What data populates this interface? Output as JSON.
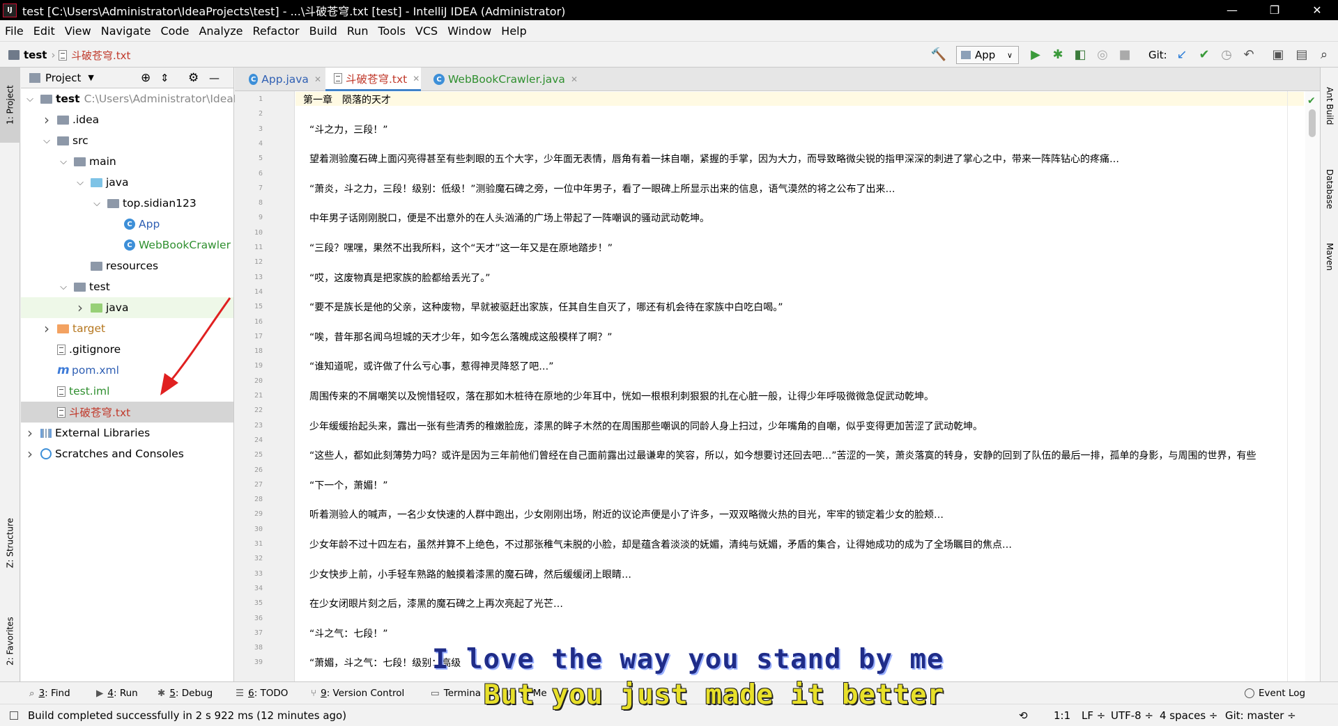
{
  "window": {
    "title": "test [C:\\Users\\Administrator\\IdeaProjects\\test] - ...\\斗破苍穹.txt [test] - IntelliJ IDEA (Administrator)",
    "app_icon": "IJ",
    "controls": [
      "—",
      "❐",
      "✕"
    ]
  },
  "menu": [
    "File",
    "Edit",
    "View",
    "Navigate",
    "Code",
    "Analyze",
    "Refactor",
    "Build",
    "Run",
    "Tools",
    "VCS",
    "Window",
    "Help"
  ],
  "breadcrumb": {
    "project": "test",
    "file": "斗破苍穹.txt"
  },
  "toolbar": {
    "run_config": "App",
    "git_label": "Git:"
  },
  "left_tool_tabs": {
    "project": "1: Project",
    "structure": "Z: Structure",
    "favorites": "2: Favorites"
  },
  "right_tool_tabs": {
    "ant": "Ant Build",
    "database": "Database",
    "maven": "Maven"
  },
  "project_panel": {
    "title": "Project",
    "tree": [
      {
        "label": "test",
        "extra": "C:\\Users\\Administrator\\IdeaP",
        "depth": 0,
        "arrow": "v",
        "icon": "folder"
      },
      {
        "label": ".idea",
        "depth": 1,
        "arrow": ">",
        "icon": "folder"
      },
      {
        "label": "src",
        "depth": 1,
        "arrow": "v",
        "icon": "folder"
      },
      {
        "label": "main",
        "depth": 2,
        "arrow": "v",
        "icon": "folder"
      },
      {
        "label": "java",
        "depth": 3,
        "arrow": "v",
        "icon": "folder-blue"
      },
      {
        "label": "top.sidian123",
        "depth": 4,
        "arrow": "v",
        "icon": "folder"
      },
      {
        "label": "App",
        "depth": 5,
        "arrow": "",
        "icon": "class",
        "color": "#2f5fb3"
      },
      {
        "label": "WebBookCrawler",
        "depth": 5,
        "arrow": "",
        "icon": "class",
        "color": "#2f8f2f"
      },
      {
        "label": "resources",
        "depth": 3,
        "arrow": "",
        "icon": "folder"
      },
      {
        "label": "test",
        "depth": 2,
        "arrow": "v",
        "icon": "folder"
      },
      {
        "label": "java",
        "depth": 3,
        "arrow": ">",
        "icon": "folder-green",
        "tested": true
      },
      {
        "label": "target",
        "depth": 1,
        "arrow": ">",
        "icon": "folder-orange",
        "color": "#b5761e"
      },
      {
        "label": ".gitignore",
        "depth": 1,
        "arrow": "",
        "icon": "file"
      },
      {
        "label": "pom.xml",
        "depth": 1,
        "arrow": "",
        "icon": "maven",
        "color": "#2f5fb3"
      },
      {
        "label": "test.iml",
        "depth": 1,
        "arrow": "",
        "icon": "file",
        "color": "#2f8f2f"
      },
      {
        "label": "斗破苍穹.txt",
        "depth": 1,
        "arrow": "",
        "icon": "file",
        "color": "#c0392b",
        "selected": true
      },
      {
        "label": "External Libraries",
        "depth": 0,
        "arrow": ">",
        "icon": "library"
      },
      {
        "label": "Scratches and Consoles",
        "depth": 0,
        "arrow": ">",
        "icon": "scratch"
      }
    ]
  },
  "tabs": [
    {
      "label": "App.java",
      "icon": "class",
      "color": "#2f5fb3"
    },
    {
      "label": "斗破苍穹.txt",
      "icon": "file",
      "color": "#c0392b",
      "active": true
    },
    {
      "label": "WebBookCrawler.java",
      "icon": "class",
      "color": "#2f8f2f"
    }
  ],
  "editor": {
    "line_numbers": [
      "1",
      "2",
      "3",
      "4",
      "5",
      "6",
      "7",
      "8",
      "9",
      "10",
      "11",
      "12",
      "13",
      "14",
      "15",
      "16",
      "17",
      "18",
      "19",
      "20",
      "21",
      "22",
      "23",
      "24",
      "25",
      "26",
      "27",
      "28",
      "29",
      "30",
      "31",
      "32",
      "33",
      "34",
      "35",
      "36",
      "37",
      "38",
      "39"
    ],
    "text_lines": [
      {
        "line": 1,
        "text": "第一章　陨落的天才",
        "first": true
      },
      {
        "line": 3,
        "text": "“斗之力，三段！”"
      },
      {
        "line": 5,
        "text": "望着测验魔石碑上面闪亮得甚至有些刺眼的五个大字，少年面无表情，唇角有着一抹自嘲，紧握的手掌，因为大力，而导致略微尖锐的指甲深深的刺进了掌心之中，带来一阵阵钻心的疼痛…"
      },
      {
        "line": 7,
        "text": "“萧炎，斗之力，三段！级别：低级！”测验魔石碑之旁，一位中年男子，看了一眼碑上所显示出来的信息，语气漠然的将之公布了出来…"
      },
      {
        "line": 9,
        "text": "中年男子话刚刚脱口，便是不出意外的在人头汹涌的广场上带起了一阵嘲讽的骚动武动乾坤。"
      },
      {
        "line": 11,
        "text": "“三段？嘿嘿，果然不出我所料，这个“天才”这一年又是在原地踏步！”"
      },
      {
        "line": 13,
        "text": "“哎，这废物真是把家族的脸都给丢光了。”"
      },
      {
        "line": 15,
        "text": "“要不是族长是他的父亲，这种废物，早就被驱赶出家族，任其自生自灭了，哪还有机会待在家族中白吃白喝。”"
      },
      {
        "line": 17,
        "text": "“唉，昔年那名闻乌坦城的天才少年，如今怎么落魄成这般模样了啊？”"
      },
      {
        "line": 19,
        "text": "“谁知道呢，或许做了什么亏心事，惹得神灵降怒了吧…”"
      },
      {
        "line": 21,
        "text": "周围传来的不屑嘲笑以及惋惜轻叹，落在那如木桩待在原地的少年耳中，恍如一根根利刺狠狠的扎在心脏一般，让得少年呼吸微微急促武动乾坤。"
      },
      {
        "line": 23,
        "text": "少年缓缓抬起头来，露出一张有些清秀的稚嫩脸庞，漆黑的眸子木然的在周围那些嘲讽的同龄人身上扫过，少年嘴角的自嘲，似乎变得更加苦涩了武动乾坤。"
      },
      {
        "line": 25,
        "text": "“这些人，都如此刻薄势力吗？或许是因为三年前他们曾经在自己面前露出过最谦卑的笑容，所以，如今想要讨还回去吧…”苦涩的一笑，萧炎落寞的转身，安静的回到了队伍的最后一排，孤单的身影，与周围的世界，有些"
      },
      {
        "line": 27,
        "text": "“下一个，萧媚！”"
      },
      {
        "line": 29,
        "text": "听着测验人的喊声，一名少女快速的人群中跑出，少女刚刚出场，附近的议论声便是小了许多，一双双略微火热的目光，牢牢的锁定着少女的脸颊…"
      },
      {
        "line": 31,
        "text": "少女年龄不过十四左右，虽然并算不上绝色，不过那张稚气未脱的小脸，却是蕴含着淡淡的妩媚，清纯与妩媚，矛盾的集合，让得她成功的成为了全场瞩目的焦点…"
      },
      {
        "line": 33,
        "text": "少女快步上前，小手轻车熟路的触摸着漆黑的魔石碑，然后缓缓闭上眼睛…"
      },
      {
        "line": 35,
        "text": "在少女闭眼片刻之后，漆黑的魔石碑之上再次亮起了光芒…"
      },
      {
        "line": 37,
        "text": "“斗之气：七段！”"
      },
      {
        "line": 39,
        "text": "“萧媚，斗之气：七段！级别：高级"
      }
    ]
  },
  "tool_windows": [
    {
      "key": "3",
      "label": ": Find",
      "icon": "search-icon"
    },
    {
      "key": "4",
      "label": ": Run",
      "icon": "run-icon"
    },
    {
      "key": "5",
      "label": ": Debug",
      "icon": "debug-icon"
    },
    {
      "key": "6",
      "label": ": TODO",
      "icon": "todo-icon"
    },
    {
      "key": "9",
      "label": ": Version Control",
      "icon": "vcs-icon"
    },
    {
      "key": "",
      "label": "Termina",
      "icon": "terminal-icon"
    },
    {
      "key": "0",
      "label": ": Me",
      "icon": "messages-icon"
    }
  ],
  "event_log": "Event Log",
  "status": {
    "message": "Build completed successfully in 2 s 922 ms (12 minutes ago)",
    "position": "1:1",
    "line_sep": "LF ÷",
    "encoding": "UTF-8 ÷",
    "indent": "4 spaces ÷",
    "git": "Git: master ÷"
  },
  "subtitles": {
    "line1": "I love the way you stand by me",
    "line2": "But you just made it better"
  }
}
